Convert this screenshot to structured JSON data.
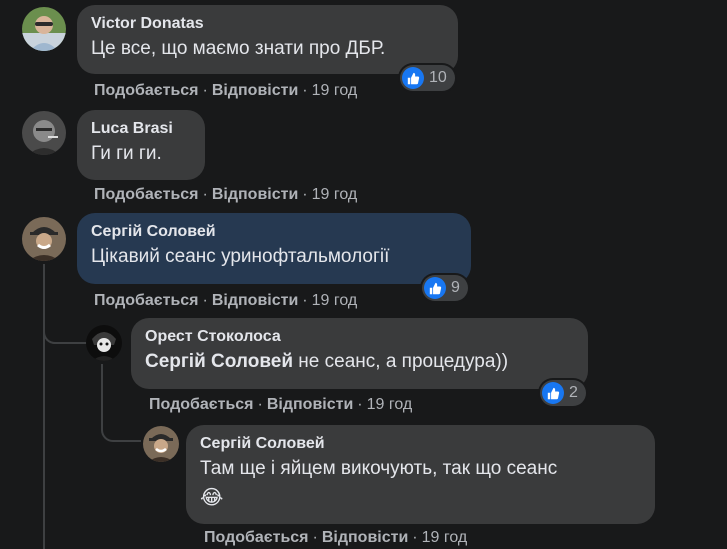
{
  "comments": [
    {
      "author": "Victor Donatas",
      "text": "Це все, що маємо знати про ДБР.",
      "like_label": "Подобається",
      "reply_label": "Відповісти",
      "time": "19 год",
      "reaction_count": "10"
    },
    {
      "author": "Luca Brasi",
      "text": "Ги ги ги.",
      "like_label": "Подобається",
      "reply_label": "Відповісти",
      "time": "19 год"
    },
    {
      "author": "Сергій Соловей",
      "text": "Цікавий сеанс уринофтальмології",
      "like_label": "Подобається",
      "reply_label": "Відповісти",
      "time": "19 год",
      "reaction_count": "9",
      "highlighted": true
    },
    {
      "author": "Орест Стоколоса",
      "mention": "Сергій Соловей",
      "text": " не сеанс, а процедура))",
      "like_label": "Подобається",
      "reply_label": "Відповісти",
      "time": "19 год",
      "reaction_count": "2"
    },
    {
      "author": "Сергій Соловей",
      "text": "Там ще і яйцем викочують, так що сеанс",
      "emoji": "😂",
      "like_label": "Подобається",
      "reply_label": "Відповісти",
      "time": "19 год"
    }
  ],
  "colors": {
    "background": "#18191a",
    "bubble": "#3a3b3c",
    "bubble_highlight": "#263951",
    "like_blue": "#1877f2",
    "secondary_text": "#b0b3b8"
  },
  "icons": {
    "reaction": "thumbs-up-icon"
  }
}
